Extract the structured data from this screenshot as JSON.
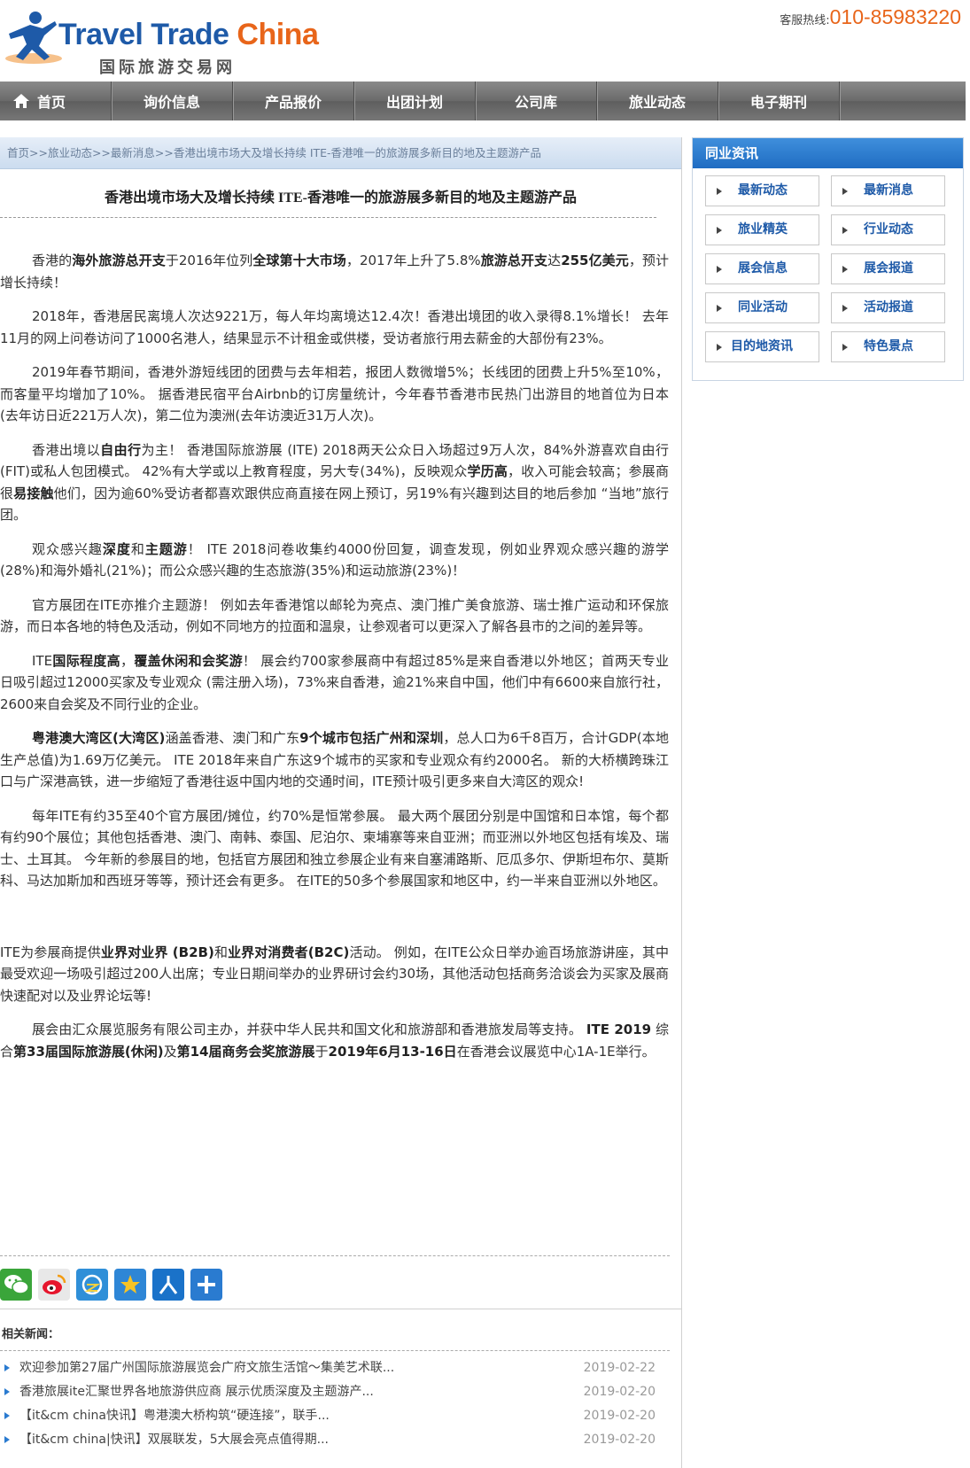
{
  "header": {
    "brand_prefix": "Travel Trade ",
    "brand_accent": "China",
    "brand_sub": "国际旅游交易网",
    "hotline_label": "客服热线:",
    "hotline_number": "010-85983220"
  },
  "nav": {
    "items": [
      "首页",
      "询价信息",
      "产品报价",
      "出团计划",
      "公司库",
      "旅业动态",
      "电子期刊"
    ]
  },
  "breadcrumb": "首页>>旅业动态>>最新消息>>香港出境市场大及增长持续 ITE-香港唯一的旅游展多新目的地及主题游产品",
  "article": {
    "title": "香港出境市场大及增长持续 ITE-香港唯一的旅游展多新目的地及主题游产品",
    "p1": {
      "a": "香港的",
      "b": "海外旅游总开支",
      "c": "于2016年位列",
      "d": "全球第十大市场",
      "e": "，2017年上升了5.8%",
      "f": "旅游总开支",
      "g": "达",
      "h": "255亿美元",
      "i": "，预计增长持续！"
    },
    "p2": "2018年，香港居民离境人次达9221万，每人年均离境达12.4次！香港出境团的收入录得8.1%增长！ 去年11月的网上问卷访问了1000名港人，结果显示不计租金或供楼，受访者旅行用去薪金的大部份有23%。",
    "p3": "2019年春节期间，香港外游短线团的团费与去年相若，报团人数微增5%；长线团的团费上升5%至10%，而客量平均增加了10%。 据香港民宿平台Airbnb的订房量统计，今年春节香港市民热门出游目的地首位为日本 (去年访日近221万人次)，第二位为澳洲(去年访澳近31万人次)。",
    "p4": {
      "a": "香港出境以",
      "b": "自由行",
      "c": "为主！ 香港国际旅游展 (ITE) 2018两天公众日入场超过9万人次，84%外游喜欢自由行(FIT)或私人包团模式。 42%有大学或以上教育程度，另大专(34%)，反映观众",
      "d": "学历高",
      "e": "，收入可能会较高；参展商很",
      "f": "易接触",
      "g": "他们，因为逾60%受访者都喜欢跟供应商直接在网上预订，另19%有兴趣到达目的地后参加 “当地”旅行团。"
    },
    "p5": {
      "a": "观众感兴趣",
      "b": "深度",
      "c": "和",
      "d": "主题游",
      "e": "！ ITE 2018问卷收集约4000份回复，调查发现，例如业界观众感兴趣的游学(28%)和海外婚礼(21%)；而公众感兴趣的生态旅游(35%)和运动旅游(23%)！"
    },
    "p6": "官方展团在ITE亦推介主题游！ 例如去年香港馆以邮轮为亮点、澳门推广美食旅游、瑞士推广运动和环保旅游，而日本各地的特色及活动，例如不同地方的拉面和温泉，让参观者可以更深入了解各县市的之间的差异等。",
    "p7": {
      "a": "ITE",
      "b": "国际程度高",
      "c": "，",
      "d": "覆盖休闲和会奖游",
      "e": "！ 展会约700家参展商中有超过85%是来自香港以外地区；首两天专业日吸引超过12000买家及专业观众 (需注册入场)，73%来自香港，逾21%来自中国，他们中有6600来自旅行社，2600来自会奖及不同行业的企业。"
    },
    "p8": {
      "a": "粤港澳大湾区(大湾区)",
      "b": "涵盖香港、澳门和广东",
      "c": "9个城市包括广州和深圳",
      "d": "，总人口为6千8百万，合计GDP(本地生产总值)为1.69万亿美元。 ITE 2018年来自广东这9个城市的买家和专业观众有约2000名。 新的大桥横跨珠江口与广深港高铁，进一步缩短了香港往返中国内地的交通时间，ITE预计吸引更多来自大湾区的观众!"
    },
    "p9": "每年ITE有约35至40个官方展团/摊位，约70%是恒常参展。 最大两个展团分别是中国馆和日本馆，每个都有约90个展位；其他包括香港、澳门、南韩、泰国、尼泊尔、柬埔寨等来自亚洲；而亚洲以外地区包括有埃及、瑞士、土耳其。 今年新的参展目的地，包括官方展团和独立参展企业有来自塞浦路斯、厄瓜多尔、伊斯坦布尔、莫斯科、马达加斯加和西班牙等等，预计还会有更多。 在ITE的50多个参展国家和地区中，约一半来自亚洲以外地区。",
    "p10": {
      "a": "ITE为参展商提供",
      "b": "业界对业界 (B2B)",
      "c": "和",
      "d": "业界对消费者(B2C)",
      "e": "活动。 例如，在ITE公众日举办逾百场旅游讲座，其中最受欢迎一场吸引超过200人出席；专业日期间举办的业界研讨会约30场，其他活动包括商务洽谈会为买家及展商快速配对以及业界论坛等!"
    },
    "p11": {
      "a": "展会由汇众展览服务有限公司主办，并获中华人民共和国文化和旅游部和香港旅发局等支持。 ",
      "b": "ITE 2019",
      "c": " 综合",
      "d": "第33届国际旅游展(休闲)",
      "e": "及",
      "f": "第14届商务会奖旅游展",
      "g": "于",
      "h": "2019年6月13-16日",
      "i": "在香港会议展览中心1A-1E举行。"
    }
  },
  "share": {
    "icons": [
      "wechat-icon",
      "weibo-icon",
      "qzone-icon",
      "favorite-icon",
      "renren-icon",
      "more-icon"
    ]
  },
  "related": {
    "title": "相关新闻：",
    "items": [
      {
        "title": "欢迎参加第27届广州国际旅游展览会广府文旅生活馆～集美艺术联...",
        "date": "2019-02-22"
      },
      {
        "title": "香港旅展ite汇聚世界各地旅游供应商 展示优质深度及主题游产...",
        "date": "2019-02-20"
      },
      {
        "title": "【it&cm china快讯】粤港澳大桥构筑“硬连接”，联手...",
        "date": "2019-02-20"
      },
      {
        "title": "【it&cm china|快讯】双展联发，5大展会亮点值得期...",
        "date": "2019-02-20"
      }
    ]
  },
  "sidebar": {
    "title": "同业资讯",
    "links": [
      "最新动态",
      "最新消息",
      "旅业精英",
      "行业动态",
      "展会信息",
      "展会报道",
      "同业活动",
      "活动报道",
      "目的地资讯",
      "特色景点"
    ]
  },
  "colors": {
    "brand_blue": "#1e5aa8",
    "accent_orange": "#e8651a",
    "nav_gray": "#6a6a6a",
    "side_head_blue": "#2a7bd0"
  }
}
